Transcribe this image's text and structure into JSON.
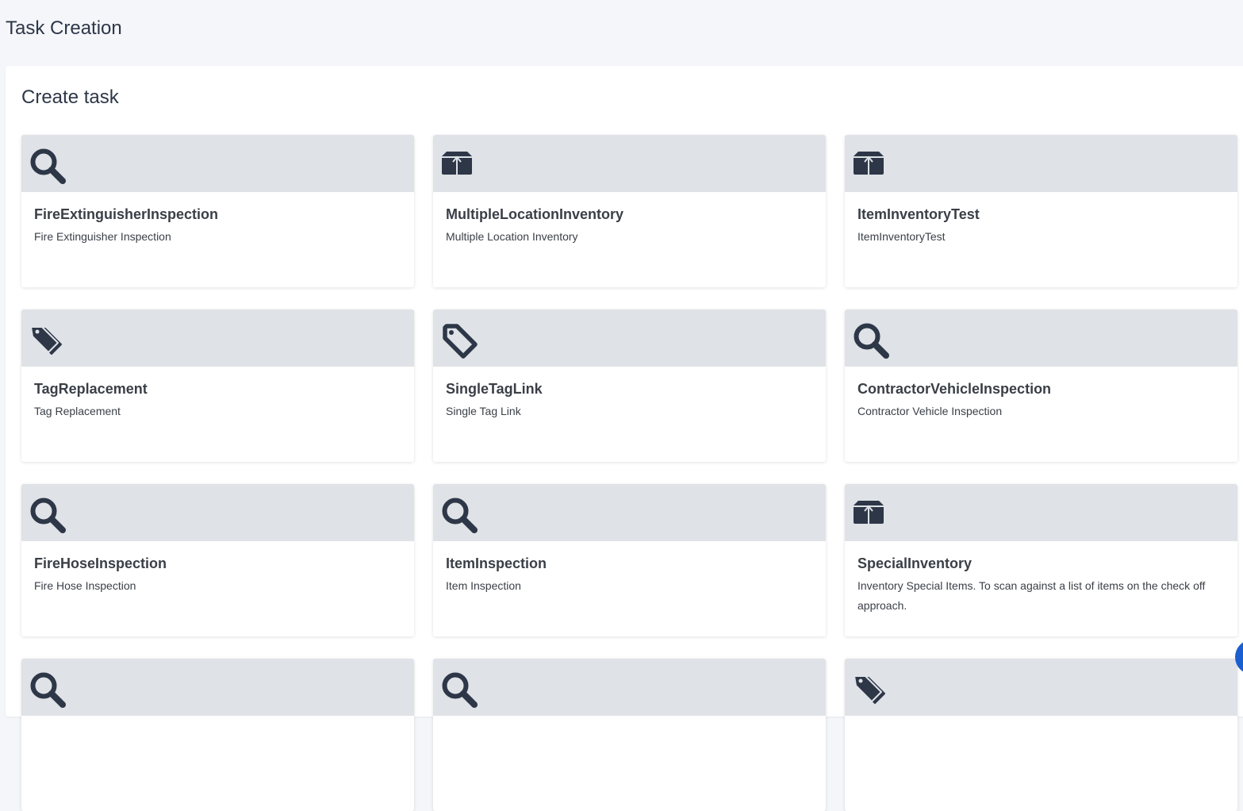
{
  "page": {
    "title": "Task Creation"
  },
  "panel": {
    "title": "Create task"
  },
  "colors": {
    "background": "#f5f6fa",
    "card_header": "#dfe2e6",
    "icon": "#2d3748",
    "accent": "#1a5fd0"
  },
  "cards": [
    {
      "icon": "search-icon",
      "name": "FireExtinguisherInspection",
      "description": "Fire Extinguisher Inspection"
    },
    {
      "icon": "box-icon",
      "name": "MultipleLocationInventory",
      "description": "Multiple Location Inventory"
    },
    {
      "icon": "box-icon",
      "name": "ItemInventoryTest",
      "description": "ItemInventoryTest"
    },
    {
      "icon": "tags-icon",
      "name": "TagReplacement",
      "description": "Tag Replacement"
    },
    {
      "icon": "tag-outline-icon",
      "name": "SingleTagLink",
      "description": "Single Tag Link"
    },
    {
      "icon": "search-icon",
      "name": "ContractorVehicleInspection",
      "description": "Contractor Vehicle Inspection"
    },
    {
      "icon": "search-icon",
      "name": "FireHoseInspection",
      "description": "Fire Hose Inspection"
    },
    {
      "icon": "search-icon",
      "name": "ItemInspection",
      "description": "Item Inspection"
    },
    {
      "icon": "box-icon",
      "name": "SpecialInventory",
      "description": "Inventory Special Items. To scan against a list of items on the check off approach."
    },
    {
      "icon": "search-icon",
      "name": "",
      "description": ""
    },
    {
      "icon": "search-icon",
      "name": "",
      "description": ""
    },
    {
      "icon": "tags-icon",
      "name": "",
      "description": ""
    }
  ]
}
